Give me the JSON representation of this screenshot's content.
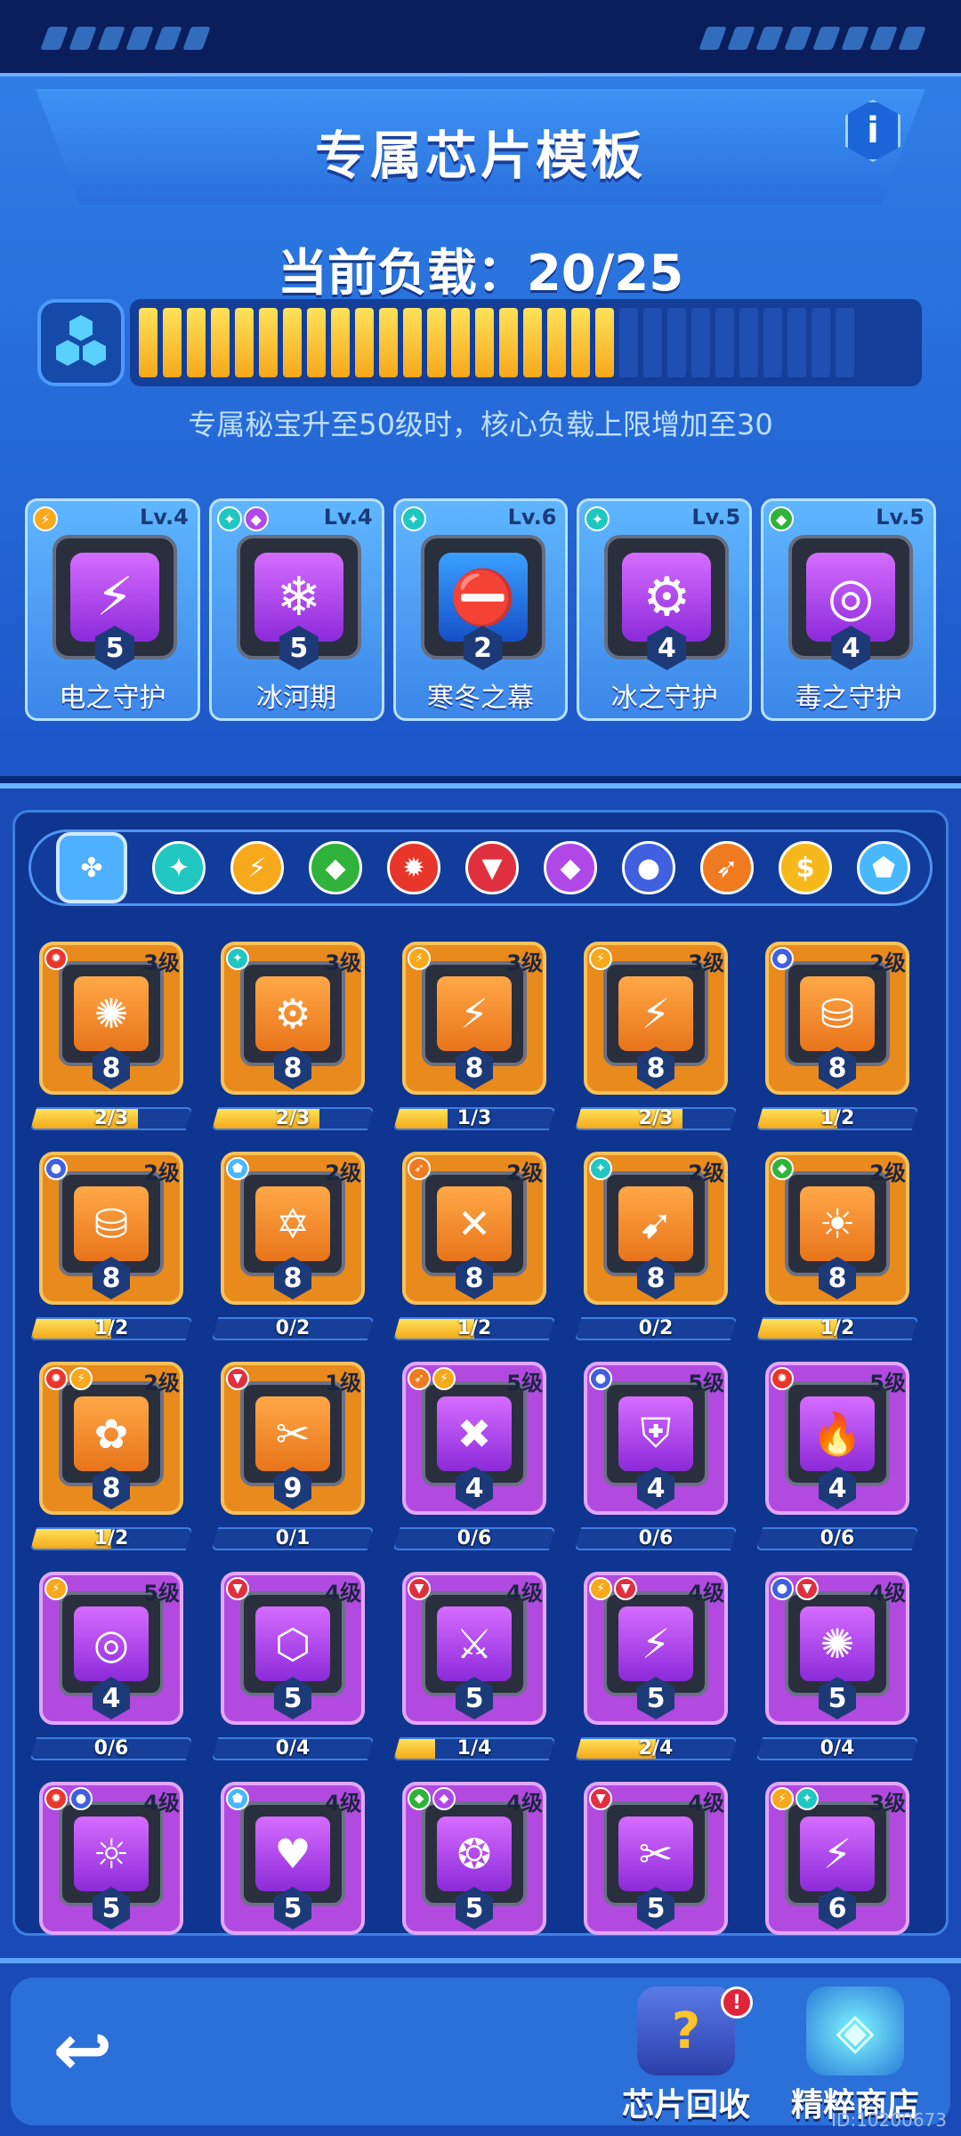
{
  "header": {
    "title": "专属芯片模板",
    "info_label": "i"
  },
  "load": {
    "label": "当前负载：20/25",
    "current": 20,
    "max": 25,
    "hint": "专属秘宝升至50级时，核心负载上限增加至30"
  },
  "equipped": [
    {
      "name": "电之守护",
      "level": "Lv.4",
      "count": "5",
      "tags": [
        {
          "c": "#f7a81b",
          "g": "⚡"
        }
      ],
      "face": "purple",
      "glyph": "⚡"
    },
    {
      "name": "冰河期",
      "level": "Lv.4",
      "count": "5",
      "tags": [
        {
          "c": "#20c7c0",
          "g": "✦"
        },
        {
          "c": "#b048e8",
          "g": "◆"
        }
      ],
      "face": "purple",
      "glyph": "❄"
    },
    {
      "name": "寒冬之幕",
      "level": "Lv.6",
      "count": "2",
      "tags": [
        {
          "c": "#20c7c0",
          "g": "✦"
        }
      ],
      "face": "blue",
      "glyph": "⛔"
    },
    {
      "name": "冰之守护",
      "level": "Lv.5",
      "count": "4",
      "tags": [
        {
          "c": "#20c7c0",
          "g": "✦"
        }
      ],
      "face": "purple",
      "glyph": "⚙"
    },
    {
      "name": "毒之守护",
      "level": "Lv.5",
      "count": "4",
      "tags": [
        {
          "c": "#2fb33a",
          "g": "◆"
        }
      ],
      "face": "purple",
      "glyph": "◎"
    }
  ],
  "filters": [
    {
      "name": "all",
      "c": "#4fb0ff",
      "g": "✤"
    },
    {
      "name": "ice",
      "c": "#20c7c0",
      "g": "✦"
    },
    {
      "name": "electric",
      "c": "#f7a81b",
      "g": "⚡"
    },
    {
      "name": "poison",
      "c": "#2fb33a",
      "g": "◆"
    },
    {
      "name": "fire",
      "c": "#e8362a",
      "g": "✹"
    },
    {
      "name": "blood",
      "c": "#e03040",
      "g": "▼"
    },
    {
      "name": "arcane",
      "c": "#b048e8",
      "g": "◆"
    },
    {
      "name": "bomb",
      "c": "#4060e0",
      "g": "●"
    },
    {
      "name": "bullet",
      "c": "#f07a20",
      "g": "➶"
    },
    {
      "name": "coin",
      "c": "#f7b81b",
      "g": "$"
    },
    {
      "name": "shield",
      "c": "#48b8ff",
      "g": "⬟"
    }
  ],
  "chips": [
    {
      "color": "orange",
      "level": "3级",
      "count": "8",
      "progress": "2/3",
      "fill": 0.67,
      "tags": [
        {
          "c": "#e8362a",
          "g": "✹"
        }
      ],
      "glyph": "✺"
    },
    {
      "color": "orange",
      "level": "3级",
      "count": "8",
      "progress": "2/3",
      "fill": 0.67,
      "tags": [
        {
          "c": "#20c7c0",
          "g": "✦"
        }
      ],
      "glyph": "⚙"
    },
    {
      "color": "orange",
      "level": "3级",
      "count": "8",
      "progress": "1/3",
      "fill": 0.33,
      "tags": [
        {
          "c": "#f7a81b",
          "g": "⚡"
        }
      ],
      "glyph": "⚡"
    },
    {
      "color": "orange",
      "level": "3级",
      "count": "8",
      "progress": "2/3",
      "fill": 0.67,
      "tags": [
        {
          "c": "#f7a81b",
          "g": "⚡"
        }
      ],
      "glyph": "⚡"
    },
    {
      "color": "orange",
      "level": "2级",
      "count": "8",
      "progress": "1/2",
      "fill": 0.5,
      "tags": [
        {
          "c": "#4060e0",
          "g": "●"
        }
      ],
      "glyph": "⛁"
    },
    {
      "color": "orange",
      "level": "2级",
      "count": "8",
      "progress": "1/2",
      "fill": 0.5,
      "tags": [
        {
          "c": "#4060e0",
          "g": "●"
        }
      ],
      "glyph": "⛁"
    },
    {
      "color": "orange",
      "level": "2级",
      "count": "8",
      "progress": "0/2",
      "fill": 0,
      "tags": [
        {
          "c": "#48b8ff",
          "g": "⬟"
        }
      ],
      "glyph": "✡"
    },
    {
      "color": "orange",
      "level": "2级",
      "count": "8",
      "progress": "1/2",
      "fill": 0.5,
      "tags": [
        {
          "c": "#f07a20",
          "g": "➶"
        }
      ],
      "glyph": "✕"
    },
    {
      "color": "orange",
      "level": "2级",
      "count": "8",
      "progress": "0/2",
      "fill": 0,
      "tags": [
        {
          "c": "#20c7c0",
          "g": "✦"
        }
      ],
      "glyph": "➹"
    },
    {
      "color": "orange",
      "level": "2级",
      "count": "8",
      "progress": "1/2",
      "fill": 0.5,
      "tags": [
        {
          "c": "#2fb33a",
          "g": "◆"
        }
      ],
      "glyph": "☀"
    },
    {
      "color": "orange",
      "level": "2级",
      "count": "8",
      "progress": "1/2",
      "fill": 0.5,
      "tags": [
        {
          "c": "#e8362a",
          "g": "✹"
        },
        {
          "c": "#f7a81b",
          "g": "⚡"
        }
      ],
      "glyph": "✿"
    },
    {
      "color": "orange",
      "level": "1级",
      "count": "9",
      "progress": "0/1",
      "fill": 0,
      "tags": [
        {
          "c": "#e03040",
          "g": "▼"
        }
      ],
      "glyph": "✂"
    },
    {
      "color": "purple",
      "level": "5级",
      "count": "4",
      "progress": "0/6",
      "fill": 0,
      "tags": [
        {
          "c": "#f07a20",
          "g": "➶"
        },
        {
          "c": "#f7a81b",
          "g": "⚡"
        }
      ],
      "glyph": "✖"
    },
    {
      "color": "purple",
      "level": "5级",
      "count": "4",
      "progress": "0/6",
      "fill": 0,
      "tags": [
        {
          "c": "#4060e0",
          "g": "●"
        }
      ],
      "glyph": "⛨"
    },
    {
      "color": "purple",
      "level": "5级",
      "count": "4",
      "progress": "0/6",
      "fill": 0,
      "tags": [
        {
          "c": "#e8362a",
          "g": "✹"
        }
      ],
      "glyph": "🔥"
    },
    {
      "color": "purple",
      "level": "5级",
      "count": "4",
      "progress": "0/6",
      "fill": 0,
      "tags": [
        {
          "c": "#f7a81b",
          "g": "⚡"
        }
      ],
      "glyph": "◎"
    },
    {
      "color": "purple",
      "level": "4级",
      "count": "5",
      "progress": "0/4",
      "fill": 0,
      "tags": [
        {
          "c": "#e03040",
          "g": "▼"
        }
      ],
      "glyph": "⬡"
    },
    {
      "color": "purple",
      "level": "4级",
      "count": "5",
      "progress": "1/4",
      "fill": 0.25,
      "tags": [
        {
          "c": "#e03040",
          "g": "▼"
        }
      ],
      "glyph": "⚔"
    },
    {
      "color": "purple",
      "level": "4级",
      "count": "5",
      "progress": "2/4",
      "fill": 0.5,
      "tags": [
        {
          "c": "#f7a81b",
          "g": "⚡"
        },
        {
          "c": "#e03040",
          "g": "▼"
        }
      ],
      "glyph": "⚡"
    },
    {
      "color": "purple",
      "level": "4级",
      "count": "5",
      "progress": "0/4",
      "fill": 0,
      "tags": [
        {
          "c": "#4060e0",
          "g": "●"
        },
        {
          "c": "#e03040",
          "g": "▼"
        }
      ],
      "glyph": "✺"
    },
    {
      "color": "purple",
      "level": "4级",
      "count": "5",
      "progress": "",
      "fill": 0,
      "tags": [
        {
          "c": "#e8362a",
          "g": "✹"
        },
        {
          "c": "#4060e0",
          "g": "●"
        }
      ],
      "glyph": "☼"
    },
    {
      "color": "purple",
      "level": "4级",
      "count": "5",
      "progress": "",
      "fill": 0,
      "tags": [
        {
          "c": "#48b8ff",
          "g": "⬟"
        }
      ],
      "glyph": "♥"
    },
    {
      "color": "purple",
      "level": "4级",
      "count": "5",
      "progress": "",
      "fill": 0,
      "tags": [
        {
          "c": "#2fb33a",
          "g": "◆"
        },
        {
          "c": "#b048e8",
          "g": "◆"
        }
      ],
      "glyph": "❂"
    },
    {
      "color": "purple",
      "level": "4级",
      "count": "5",
      "progress": "",
      "fill": 0,
      "tags": [
        {
          "c": "#e03040",
          "g": "▼"
        }
      ],
      "glyph": "✂"
    },
    {
      "color": "purple",
      "level": "3级",
      "count": "6",
      "progress": "",
      "fill": 0,
      "tags": [
        {
          "c": "#f7a81b",
          "g": "⚡"
        },
        {
          "c": "#20c7c0",
          "g": "✦"
        }
      ],
      "glyph": "⚡"
    }
  ],
  "footer": {
    "back_glyph": "↩",
    "recycle_label": "芯片回收",
    "recycle_badge": "!",
    "shop_label": "精粹商店",
    "id_text": "ID:10200673"
  }
}
